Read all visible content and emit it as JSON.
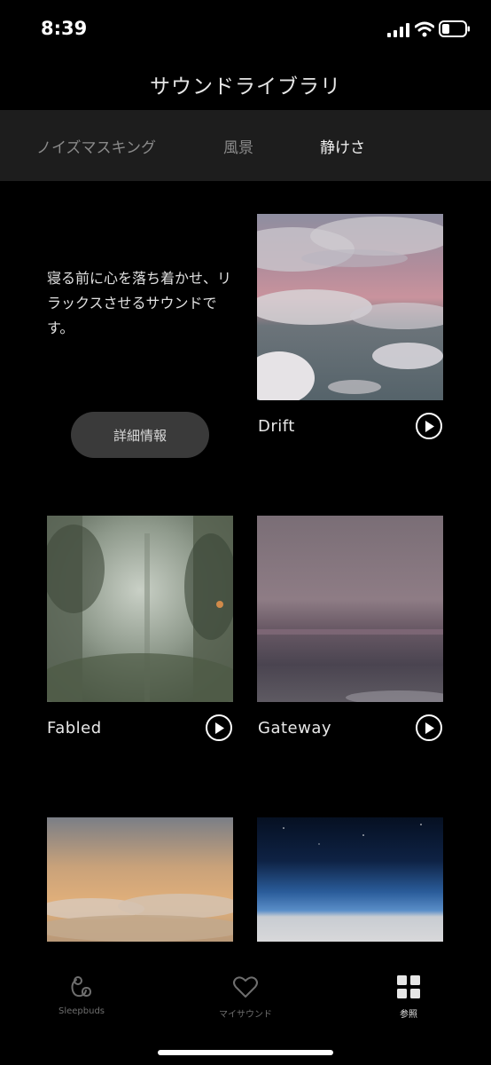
{
  "status_bar": {
    "time": "8:39"
  },
  "header": {
    "title": "サウンドライブラリ"
  },
  "tabs": [
    {
      "label": "ノイズマスキング"
    },
    {
      "label": "風景"
    },
    {
      "label": "静けさ"
    }
  ],
  "intro": {
    "description": "寝る前に心を落ち着かせ、リラックスさせるサウンドです。",
    "details_label": "詳細情報"
  },
  "sounds": [
    {
      "name": "Drift"
    },
    {
      "name": "Fabled"
    },
    {
      "name": "Gateway"
    },
    {
      "name": ""
    },
    {
      "name": ""
    }
  ],
  "nav": [
    {
      "label": "Sleepbuds",
      "icon": "sleepbuds-icon"
    },
    {
      "label": "マイサウンド",
      "icon": "heart-icon"
    },
    {
      "label": "参照",
      "icon": "grid-icon"
    }
  ],
  "colors": {
    "background": "#000000",
    "tab_bar": "#1d1d1d",
    "button": "#3a3a3a"
  }
}
